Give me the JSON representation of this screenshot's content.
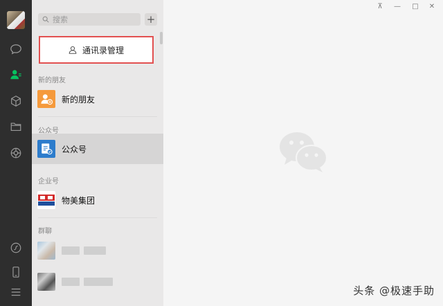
{
  "search": {
    "placeholder": "搜索",
    "add_label": "+"
  },
  "manage_button": {
    "label": "通讯录管理"
  },
  "sections": {
    "new_friends": "新的朋友",
    "official_accounts": "公众号",
    "enterprise": "企业号",
    "groups": "群聊"
  },
  "rows": {
    "new_friends": "新的朋友",
    "official_accounts": "公众号",
    "enterprise": "物美集团"
  },
  "nav": {
    "icons": [
      "chat-icon",
      "contacts-icon",
      "favorites-icon",
      "files-icon",
      "moments-icon",
      "mini-program-icon",
      "phone-icon",
      "menu-icon"
    ]
  },
  "window_controls": {
    "pin": "⊼",
    "minimize": "—",
    "maximize": "□",
    "close": "✕"
  },
  "watermark": "头条 @极速手助",
  "colors": {
    "accent_green": "#07c160",
    "highlight_red": "#e25050",
    "new_friend_orange": "#f59a3c",
    "official_blue": "#2d7ccc"
  }
}
